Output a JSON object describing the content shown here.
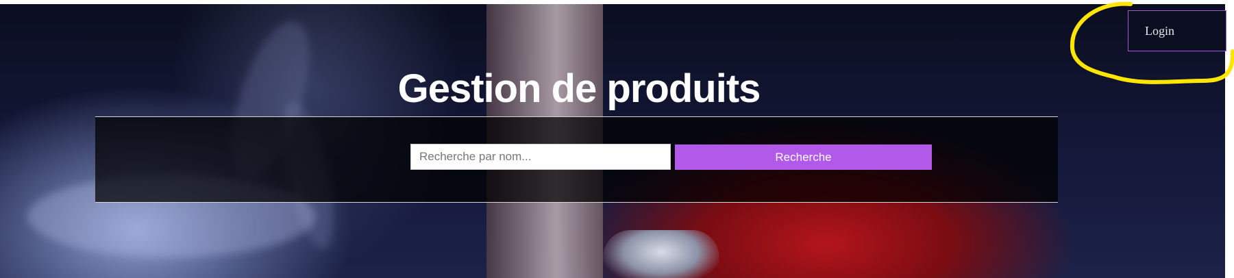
{
  "header": {
    "title": "Gestion de produits",
    "login_label": "Login"
  },
  "search": {
    "placeholder": "Recherche par nom...",
    "value": "",
    "button_label": "Recherche"
  },
  "colors": {
    "accent": "#b259ea",
    "annotation": "#ffe600",
    "login_border": "#a05cd6"
  }
}
